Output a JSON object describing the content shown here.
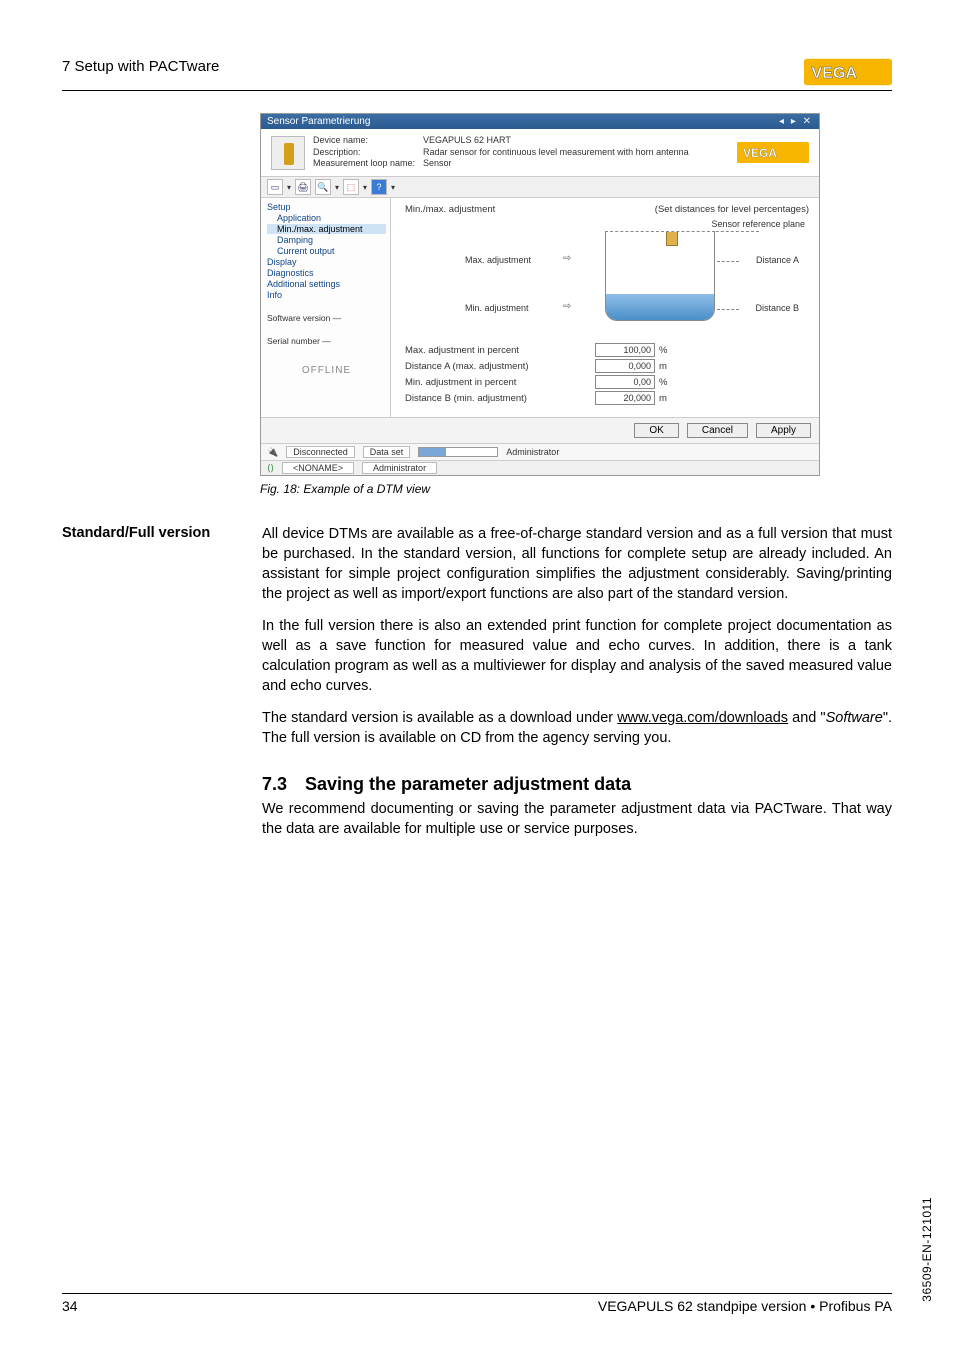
{
  "header": {
    "title": "7 Setup with PACTware"
  },
  "screenshot": {
    "titlebar": "Sensor Parametrierung",
    "device": {
      "name_label": "Device name:",
      "name_value": "VEGAPULS 62 HART",
      "desc_label": "Description:",
      "desc_value": "Radar sensor for continuous level measurement with horn antenna",
      "loop_label": "Measurement loop name:",
      "loop_value": "Sensor"
    },
    "tree": {
      "setup": "Setup",
      "application": "Application",
      "minmax": "Min./max. adjustment",
      "damping": "Damping",
      "current": "Current output",
      "display": "Display",
      "diagnostics": "Diagnostics",
      "additional": "Additional settings",
      "info": "Info",
      "software": "Software version  —",
      "serial": "Serial number     —",
      "offline": "OFFLINE"
    },
    "main": {
      "heading_left": "Min./max. adjustment",
      "heading_right": "(Set distances for level percentages)",
      "ref_plane": "Sensor reference plane",
      "max_adj": "Max. adjustment",
      "min_adj": "Min. adjustment",
      "dist_a": "Distance A",
      "dist_b": "Distance B",
      "fields": {
        "max_pct_label": "Max. adjustment in percent",
        "max_pct_value": "100,00",
        "max_pct_unit": "%",
        "dist_a_label": "Distance A (max. adjustment)",
        "dist_a_value": "0,000",
        "dist_a_unit": "m",
        "min_pct_label": "Min. adjustment in percent",
        "min_pct_value": "0,00",
        "min_pct_unit": "%",
        "dist_b_label": "Distance B (min. adjustment)",
        "dist_b_value": "20,000",
        "dist_b_unit": "m"
      }
    },
    "buttons": {
      "ok": "OK",
      "cancel": "Cancel",
      "apply": "Apply"
    },
    "status": {
      "disconnected": "Disconnected",
      "dataset": "Data set",
      "admin": "Administrator"
    },
    "extra": {
      "noname": "<NONAME>",
      "admin": "Administrator"
    }
  },
  "caption": "Fig. 18: Example of a DTM view",
  "section": {
    "sidehead": "Standard/Full version",
    "p1": "All device DTMs are available as a free-of-charge standard version and as a full version that must be purchased. In the standard version, all functions for complete setup are already included. An assistant for simple project configuration simplifies the adjustment considerably. Saving/printing the project as well as import/export functions are also part of the standard version.",
    "p2": "In the full version there is also an extended print function for complete project documentation as well as a save function for measured value and echo curves. In addition, there is a tank calculation program as well as a multiviewer for display and analysis of the saved measured value and echo curves.",
    "p3a": "The standard version is available as a download under ",
    "p3link": "www.vega.com/downloads",
    "p3b": " and \"",
    "p3i": "Software",
    "p3c": "\". The full version is available on CD from the agency serving you."
  },
  "h2": {
    "num": "7.3",
    "title": "Saving the parameter adjustment data"
  },
  "h2body": "We recommend documenting or saving the parameter adjustment data via PACTware. That way the data are available for multiple use or service purposes.",
  "footer": {
    "page": "34",
    "product": "VEGAPULS 62 standpipe version • Profibus PA"
  },
  "sidecode": "36509-EN-121011"
}
